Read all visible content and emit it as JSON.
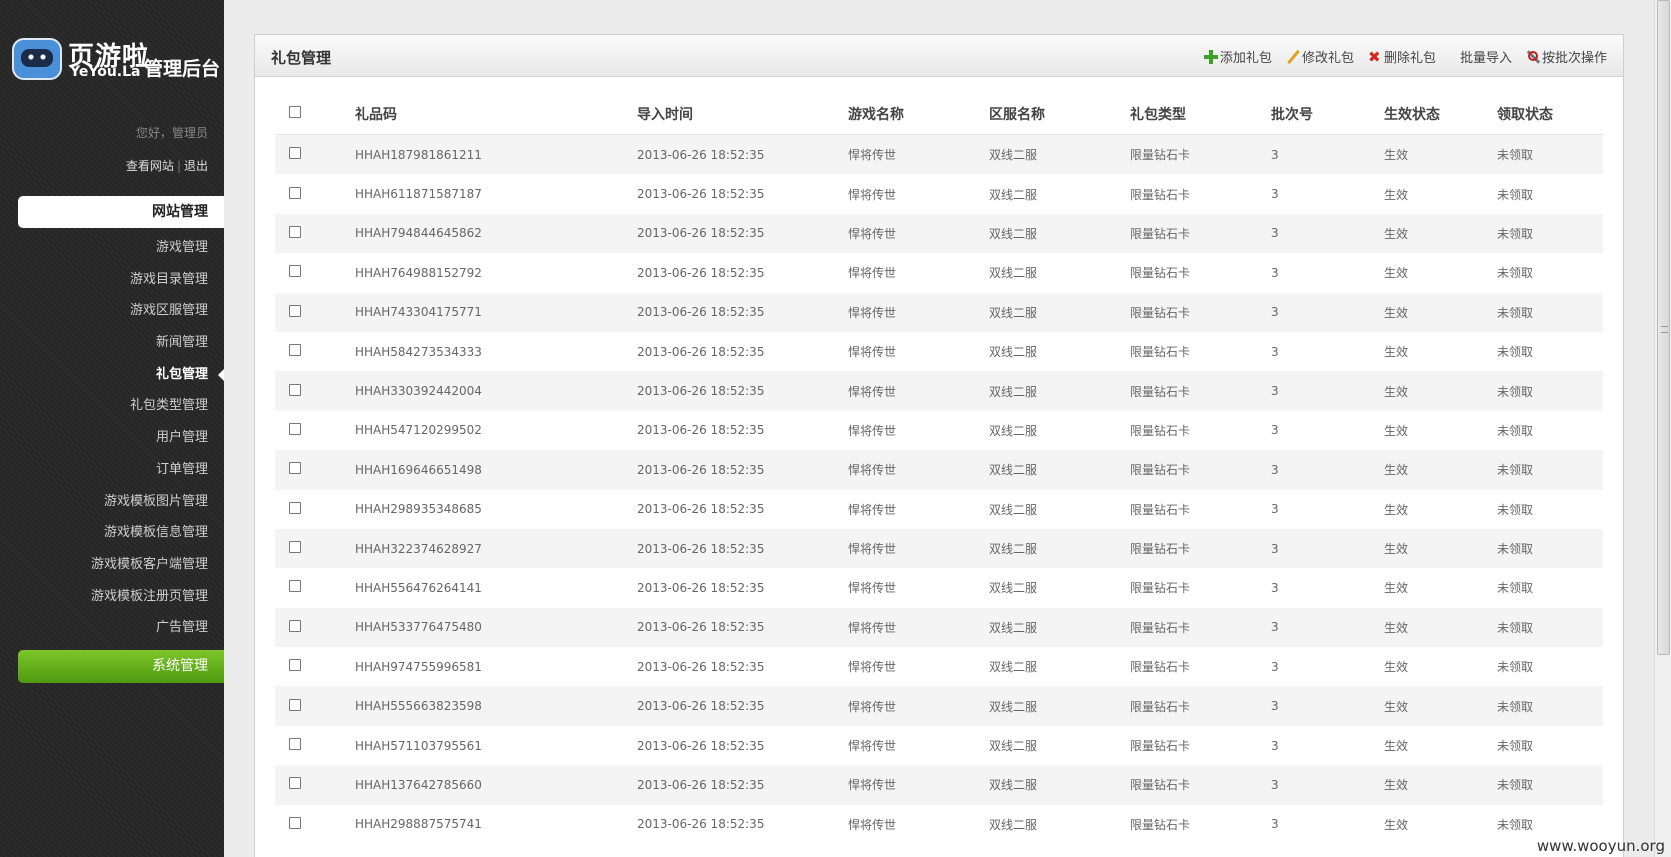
{
  "sidebar": {
    "brand_cn": "页游啦",
    "brand_en": "YeYou.La",
    "admin_title": "管理后台",
    "greeting": "您好，管理员",
    "view_site": "查看网站",
    "separator": "|",
    "logout": "退出",
    "section_site": "网站管理",
    "items": [
      {
        "label": "游戏管理",
        "active": false
      },
      {
        "label": "游戏目录管理",
        "active": false
      },
      {
        "label": "游戏区服管理",
        "active": false
      },
      {
        "label": "新闻管理",
        "active": false
      },
      {
        "label": "礼包管理",
        "active": true
      },
      {
        "label": "礼包类型管理",
        "active": false
      },
      {
        "label": "用户管理",
        "active": false
      },
      {
        "label": "订单管理",
        "active": false
      },
      {
        "label": "游戏模板图片管理",
        "active": false
      },
      {
        "label": "游戏模板信息管理",
        "active": false
      },
      {
        "label": "游戏模板客户端管理",
        "active": false
      },
      {
        "label": "游戏模板注册页管理",
        "active": false
      },
      {
        "label": "广告管理",
        "active": false
      }
    ],
    "section_system": "系统管理",
    "accent_color": "#6ab71f"
  },
  "panel": {
    "title": "礼包管理",
    "toolbar": {
      "add": "添加礼包",
      "edit": "修改礼包",
      "delete": "删除礼包",
      "import": "批量导入",
      "batch": "按批次操作"
    }
  },
  "table": {
    "headers": [
      "礼品码",
      "导入时间",
      "游戏名称",
      "区服名称",
      "礼包类型",
      "批次号",
      "生效状态",
      "领取状态"
    ],
    "rows": [
      [
        "HHAH187981861211",
        "2013-06-26 18:52:35",
        "悍将传世",
        "双线二服",
        "限量钻石卡",
        "3",
        "生效",
        "未领取"
      ],
      [
        "HHAH611871587187",
        "2013-06-26 18:52:35",
        "悍将传世",
        "双线二服",
        "限量钻石卡",
        "3",
        "生效",
        "未领取"
      ],
      [
        "HHAH794844645862",
        "2013-06-26 18:52:35",
        "悍将传世",
        "双线二服",
        "限量钻石卡",
        "3",
        "生效",
        "未领取"
      ],
      [
        "HHAH764988152792",
        "2013-06-26 18:52:35",
        "悍将传世",
        "双线二服",
        "限量钻石卡",
        "3",
        "生效",
        "未领取"
      ],
      [
        "HHAH743304175771",
        "2013-06-26 18:52:35",
        "悍将传世",
        "双线二服",
        "限量钻石卡",
        "3",
        "生效",
        "未领取"
      ],
      [
        "HHAH584273534333",
        "2013-06-26 18:52:35",
        "悍将传世",
        "双线二服",
        "限量钻石卡",
        "3",
        "生效",
        "未领取"
      ],
      [
        "HHAH330392442004",
        "2013-06-26 18:52:35",
        "悍将传世",
        "双线二服",
        "限量钻石卡",
        "3",
        "生效",
        "未领取"
      ],
      [
        "HHAH547120299502",
        "2013-06-26 18:52:35",
        "悍将传世",
        "双线二服",
        "限量钻石卡",
        "3",
        "生效",
        "未领取"
      ],
      [
        "HHAH169646651498",
        "2013-06-26 18:52:35",
        "悍将传世",
        "双线二服",
        "限量钻石卡",
        "3",
        "生效",
        "未领取"
      ],
      [
        "HHAH298935348685",
        "2013-06-26 18:52:35",
        "悍将传世",
        "双线二服",
        "限量钻石卡",
        "3",
        "生效",
        "未领取"
      ],
      [
        "HHAH322374628927",
        "2013-06-26 18:52:35",
        "悍将传世",
        "双线二服",
        "限量钻石卡",
        "3",
        "生效",
        "未领取"
      ],
      [
        "HHAH556476264141",
        "2013-06-26 18:52:35",
        "悍将传世",
        "双线二服",
        "限量钻石卡",
        "3",
        "生效",
        "未领取"
      ],
      [
        "HHAH533776475480",
        "2013-06-26 18:52:35",
        "悍将传世",
        "双线二服",
        "限量钻石卡",
        "3",
        "生效",
        "未领取"
      ],
      [
        "HHAH974755996581",
        "2013-06-26 18:52:35",
        "悍将传世",
        "双线二服",
        "限量钻石卡",
        "3",
        "生效",
        "未领取"
      ],
      [
        "HHAH555663823598",
        "2013-06-26 18:52:35",
        "悍将传世",
        "双线二服",
        "限量钻石卡",
        "3",
        "生效",
        "未领取"
      ],
      [
        "HHAH571103795561",
        "2013-06-26 18:52:35",
        "悍将传世",
        "双线二服",
        "限量钻石卡",
        "3",
        "生效",
        "未领取"
      ],
      [
        "HHAH137642785660",
        "2013-06-26 18:52:35",
        "悍将传世",
        "双线二服",
        "限量钻石卡",
        "3",
        "生效",
        "未领取"
      ],
      [
        "HHAH298887575741",
        "2013-06-26 18:52:35",
        "悍将传世",
        "双线二服",
        "限量钻石卡",
        "3",
        "生效",
        "未领取"
      ]
    ]
  },
  "watermark": "www.wooyun.org"
}
